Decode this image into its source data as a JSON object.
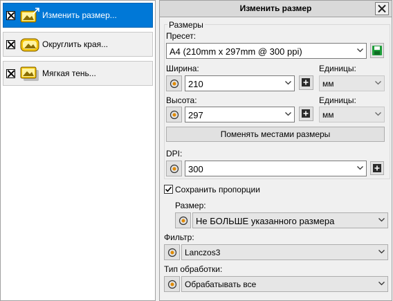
{
  "operations": [
    {
      "label": "Изменить размер...",
      "checked": true,
      "selected": true,
      "icon": "resize-icon"
    },
    {
      "label": "Округлить края...",
      "checked": true,
      "selected": false,
      "icon": "round-corners-icon"
    },
    {
      "label": "Мягкая тень...",
      "checked": true,
      "selected": false,
      "icon": "soft-shadow-icon"
    }
  ],
  "panel": {
    "title": "Изменить размер",
    "close_label": "✕"
  },
  "sizes_group": {
    "title": "Размеры",
    "preset_label": "Пресет:",
    "preset_value": "A4 (210mm x 297mm @ 300 ppi)",
    "width_label": "Ширина:",
    "width_value": "210",
    "height_label": "Высота:",
    "height_value": "297",
    "units_label": "Единицы:",
    "width_units": "мм",
    "height_units": "мм",
    "swap_label": "Поменять местами размеры",
    "dpi_label": "DPI:",
    "dpi_value": "300"
  },
  "options": {
    "keep_aspect_label": "Сохранить пропорции",
    "keep_aspect_checked": true,
    "size_mode_label": "Размер:",
    "size_mode_value": "Не БОЛЬШЕ указанного размера",
    "filter_label": "Фильтр:",
    "filter_value": "Lanczos3",
    "processing_label": "Тип обработки:",
    "processing_value": "Обрабатывать все"
  },
  "colors": {
    "selection": "#0078d7",
    "save_icon": "#1e9e3a"
  }
}
